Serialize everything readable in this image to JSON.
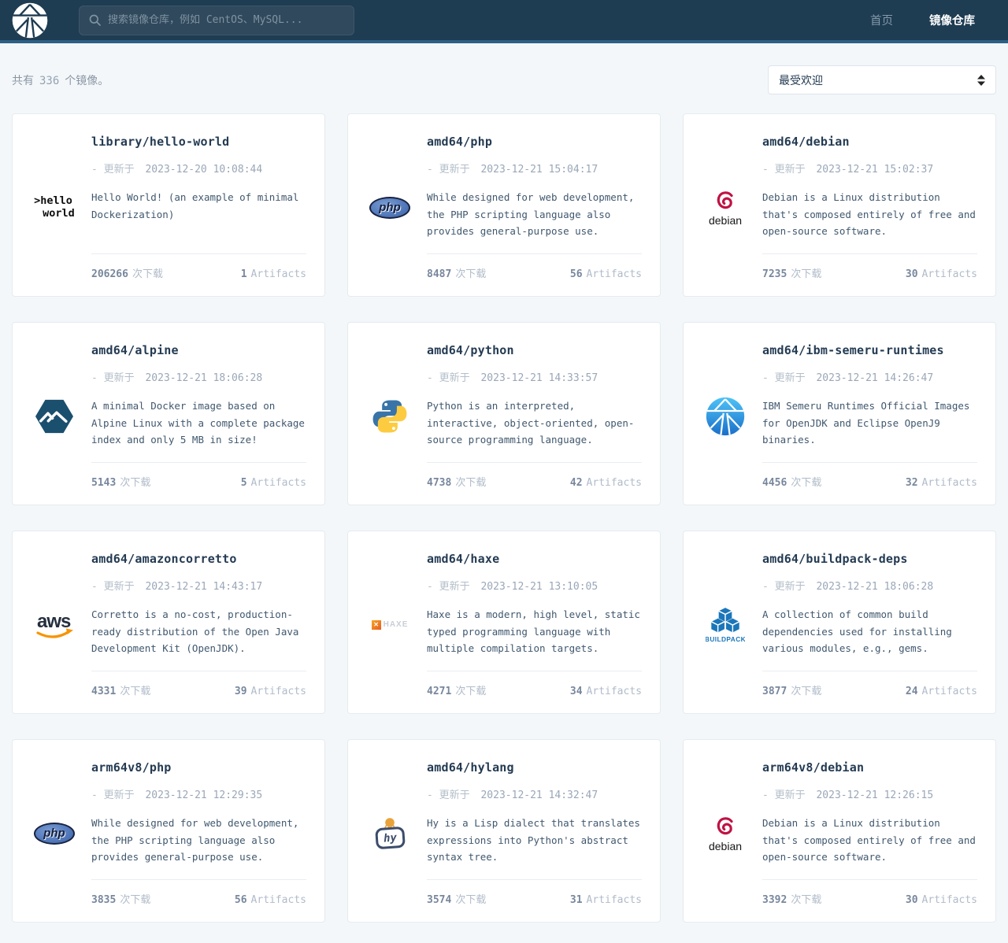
{
  "navbar": {
    "logo": "atomhub-site-logo",
    "search_placeholder": "搜索镜像仓库，例如 CentOS、MySQL...",
    "links": [
      {
        "label": "首页",
        "active": false
      },
      {
        "label": "镜像仓库",
        "active": true
      }
    ]
  },
  "toolbar": {
    "total_prefix": "共有",
    "total_count": "336",
    "total_suffix": "个镜像。",
    "sort_value": "最受欢迎"
  },
  "labels": {
    "updated_prefix": "- 更新于",
    "downloads_suffix": "次下载",
    "artifacts_suffix": "Artifacts"
  },
  "cards": [
    {
      "title": "library/hello-world",
      "updated": "2023-12-20 10:08:44",
      "description": "Hello World! (an example of minimal Dockerization)",
      "downloads": "206266",
      "artifacts": "1",
      "logo": "hello-world"
    },
    {
      "title": "amd64/php",
      "updated": "2023-12-21 15:04:17",
      "description": "While designed for web development, the PHP scripting language also provides general-purpose use.",
      "downloads": "8487",
      "artifacts": "56",
      "logo": "php"
    },
    {
      "title": "amd64/debian",
      "updated": "2023-12-21 15:02:37",
      "description": "Debian is a Linux distribution that's composed entirely of free and open-source software.",
      "downloads": "7235",
      "artifacts": "30",
      "logo": "debian"
    },
    {
      "title": "amd64/alpine",
      "updated": "2023-12-21 18:06:28",
      "description": "A minimal Docker image based on Alpine Linux with a complete package index and only 5 MB in size!",
      "downloads": "5143",
      "artifacts": "5",
      "logo": "alpine"
    },
    {
      "title": "amd64/python",
      "updated": "2023-12-21 14:33:57",
      "description": "Python is an interpreted, interactive, object-oriented, open-source programming language.",
      "downloads": "4738",
      "artifacts": "42",
      "logo": "python"
    },
    {
      "title": "amd64/ibm-semeru-runtimes",
      "updated": "2023-12-21 14:26:47",
      "description": "IBM Semeru Runtimes Official Images for OpenJDK and Eclipse OpenJ9 binaries.",
      "downloads": "4456",
      "artifacts": "32",
      "logo": "atomhub"
    },
    {
      "title": "amd64/amazoncorretto",
      "updated": "2023-12-21 14:43:17",
      "description": "Corretto is a no-cost, production-ready distribution of the Open Java Development Kit (OpenJDK).",
      "downloads": "4331",
      "artifacts": "39",
      "logo": "aws"
    },
    {
      "title": "amd64/haxe",
      "updated": "2023-12-21 13:10:05",
      "description": "Haxe is a modern, high level, static typed programming language with multiple compilation targets.",
      "downloads": "4271",
      "artifacts": "34",
      "logo": "haxe"
    },
    {
      "title": "amd64/buildpack-deps",
      "updated": "2023-12-21 18:06:28",
      "description": "A collection of common build dependencies used for installing various modules, e.g., gems.",
      "downloads": "3877",
      "artifacts": "24",
      "logo": "buildpack"
    },
    {
      "title": "arm64v8/php",
      "updated": "2023-12-21 12:29:35",
      "description": "While designed for web development, the PHP scripting language also provides general-purpose use.",
      "downloads": "3835",
      "artifacts": "56",
      "logo": "php"
    },
    {
      "title": "amd64/hylang",
      "updated": "2023-12-21 14:32:47",
      "description": "Hy is a Lisp dialect that translates expressions into Python's abstract syntax tree.",
      "downloads": "3574",
      "artifacts": "31",
      "logo": "hylang"
    },
    {
      "title": "arm64v8/debian",
      "updated": "2023-12-21 12:26:15",
      "description": "Debian is a Linux distribution that's composed entirely of free and open-source software.",
      "downloads": "3392",
      "artifacts": "30",
      "logo": "debian"
    }
  ],
  "colors": {
    "navbar_bg": "#1e3c52",
    "navbar_border": "#2d6086",
    "page_bg": "#f4f7f9",
    "card_border": "#e5ebf0",
    "title_text": "#243b53",
    "muted_text": "#9aa7b7",
    "description_text": "#40586e",
    "stat_number": "#77879d",
    "stat_label": "#b0bbc9",
    "link_active": "#ffffff",
    "link_inactive": "#8599a9"
  }
}
